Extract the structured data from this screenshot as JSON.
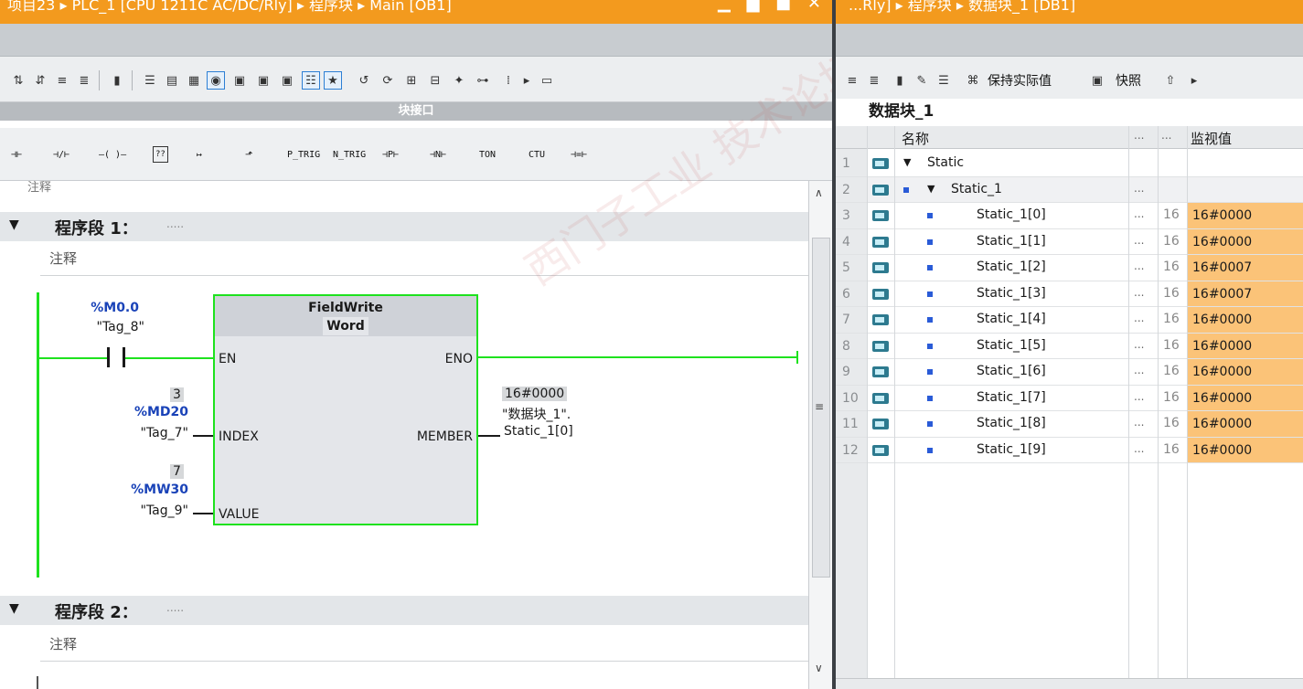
{
  "left": {
    "title": "项目23 ▸ PLC_1 [CPU 1211C AC/DC/Rly] ▸ 程序块 ▸ Main [OB1]",
    "window_buttons": "▁ ▆ ■ ✕",
    "interface_bar": "块接口",
    "instructions": [
      "P_TRIG",
      "N_TRIG",
      "TON",
      "CTU"
    ],
    "top_comment": "注释",
    "network1": {
      "label": "程序段 1：",
      "dots": ".....",
      "comment": "注释"
    },
    "network2": {
      "label": "程序段 2：",
      "dots": ".....",
      "comment": "注释"
    },
    "block": {
      "name": "FieldWrite",
      "type": "Word",
      "pins": {
        "en": "EN",
        "eno": "ENO",
        "index": "INDEX",
        "member": "MEMBER",
        "value": "VALUE"
      }
    },
    "contact": {
      "address": "%M0.0",
      "tag": "\"Tag_8\""
    },
    "index": {
      "value": "3",
      "address": "%MD20",
      "tag": "\"Tag_7\""
    },
    "value": {
      "value": "7",
      "address": "%MW30",
      "tag": "\"Tag_9\""
    },
    "member": {
      "value": "16#0000",
      "tag_line1": "\"数据块_1\".",
      "tag_line2": "Static_1[0]"
    }
  },
  "right": {
    "title": "...Rly] ▸ 程序块 ▸ 数据块_1 [DB1]",
    "toolbar": {
      "keep_actual": "保持实际值",
      "snapshot": "快照"
    },
    "db_name": "数据块_1",
    "headers": {
      "name": "名称",
      "dots1": "...",
      "dots2": "...",
      "monitor": "监视值"
    },
    "rows": [
      {
        "num": "1",
        "name": "Static",
        "ell": "",
        "c16": "",
        "mon": "",
        "level": 0,
        "tri": "▼"
      },
      {
        "num": "2",
        "name": "Static_1",
        "ell": "...",
        "c16": "",
        "mon": "",
        "level": 1,
        "tri": "▼"
      },
      {
        "num": "3",
        "name": "Static_1[0]",
        "ell": "...",
        "c16": "16",
        "mon": "16#0000",
        "level": 2,
        "tri": ""
      },
      {
        "num": "4",
        "name": "Static_1[1]",
        "ell": "...",
        "c16": "16",
        "mon": "16#0000",
        "level": 2,
        "tri": ""
      },
      {
        "num": "5",
        "name": "Static_1[2]",
        "ell": "...",
        "c16": "16",
        "mon": "16#0007",
        "level": 2,
        "tri": ""
      },
      {
        "num": "6",
        "name": "Static_1[3]",
        "ell": "...",
        "c16": "16",
        "mon": "16#0007",
        "level": 2,
        "tri": ""
      },
      {
        "num": "7",
        "name": "Static_1[4]",
        "ell": "...",
        "c16": "16",
        "mon": "16#0000",
        "level": 2,
        "tri": ""
      },
      {
        "num": "8",
        "name": "Static_1[5]",
        "ell": "...",
        "c16": "16",
        "mon": "16#0000",
        "level": 2,
        "tri": ""
      },
      {
        "num": "9",
        "name": "Static_1[6]",
        "ell": "...",
        "c16": "16",
        "mon": "16#0000",
        "level": 2,
        "tri": ""
      },
      {
        "num": "10",
        "name": "Static_1[7]",
        "ell": "...",
        "c16": "16",
        "mon": "16#0000",
        "level": 2,
        "tri": ""
      },
      {
        "num": "11",
        "name": "Static_1[8]",
        "ell": "...",
        "c16": "16",
        "mon": "16#0000",
        "level": 2,
        "tri": ""
      },
      {
        "num": "12",
        "name": "Static_1[9]",
        "ell": "...",
        "c16": "16",
        "mon": "16#0000",
        "level": 2,
        "tri": ""
      }
    ]
  },
  "watermark": "西门子工业 技术论坛 support.industry.siemens.com/cs"
}
